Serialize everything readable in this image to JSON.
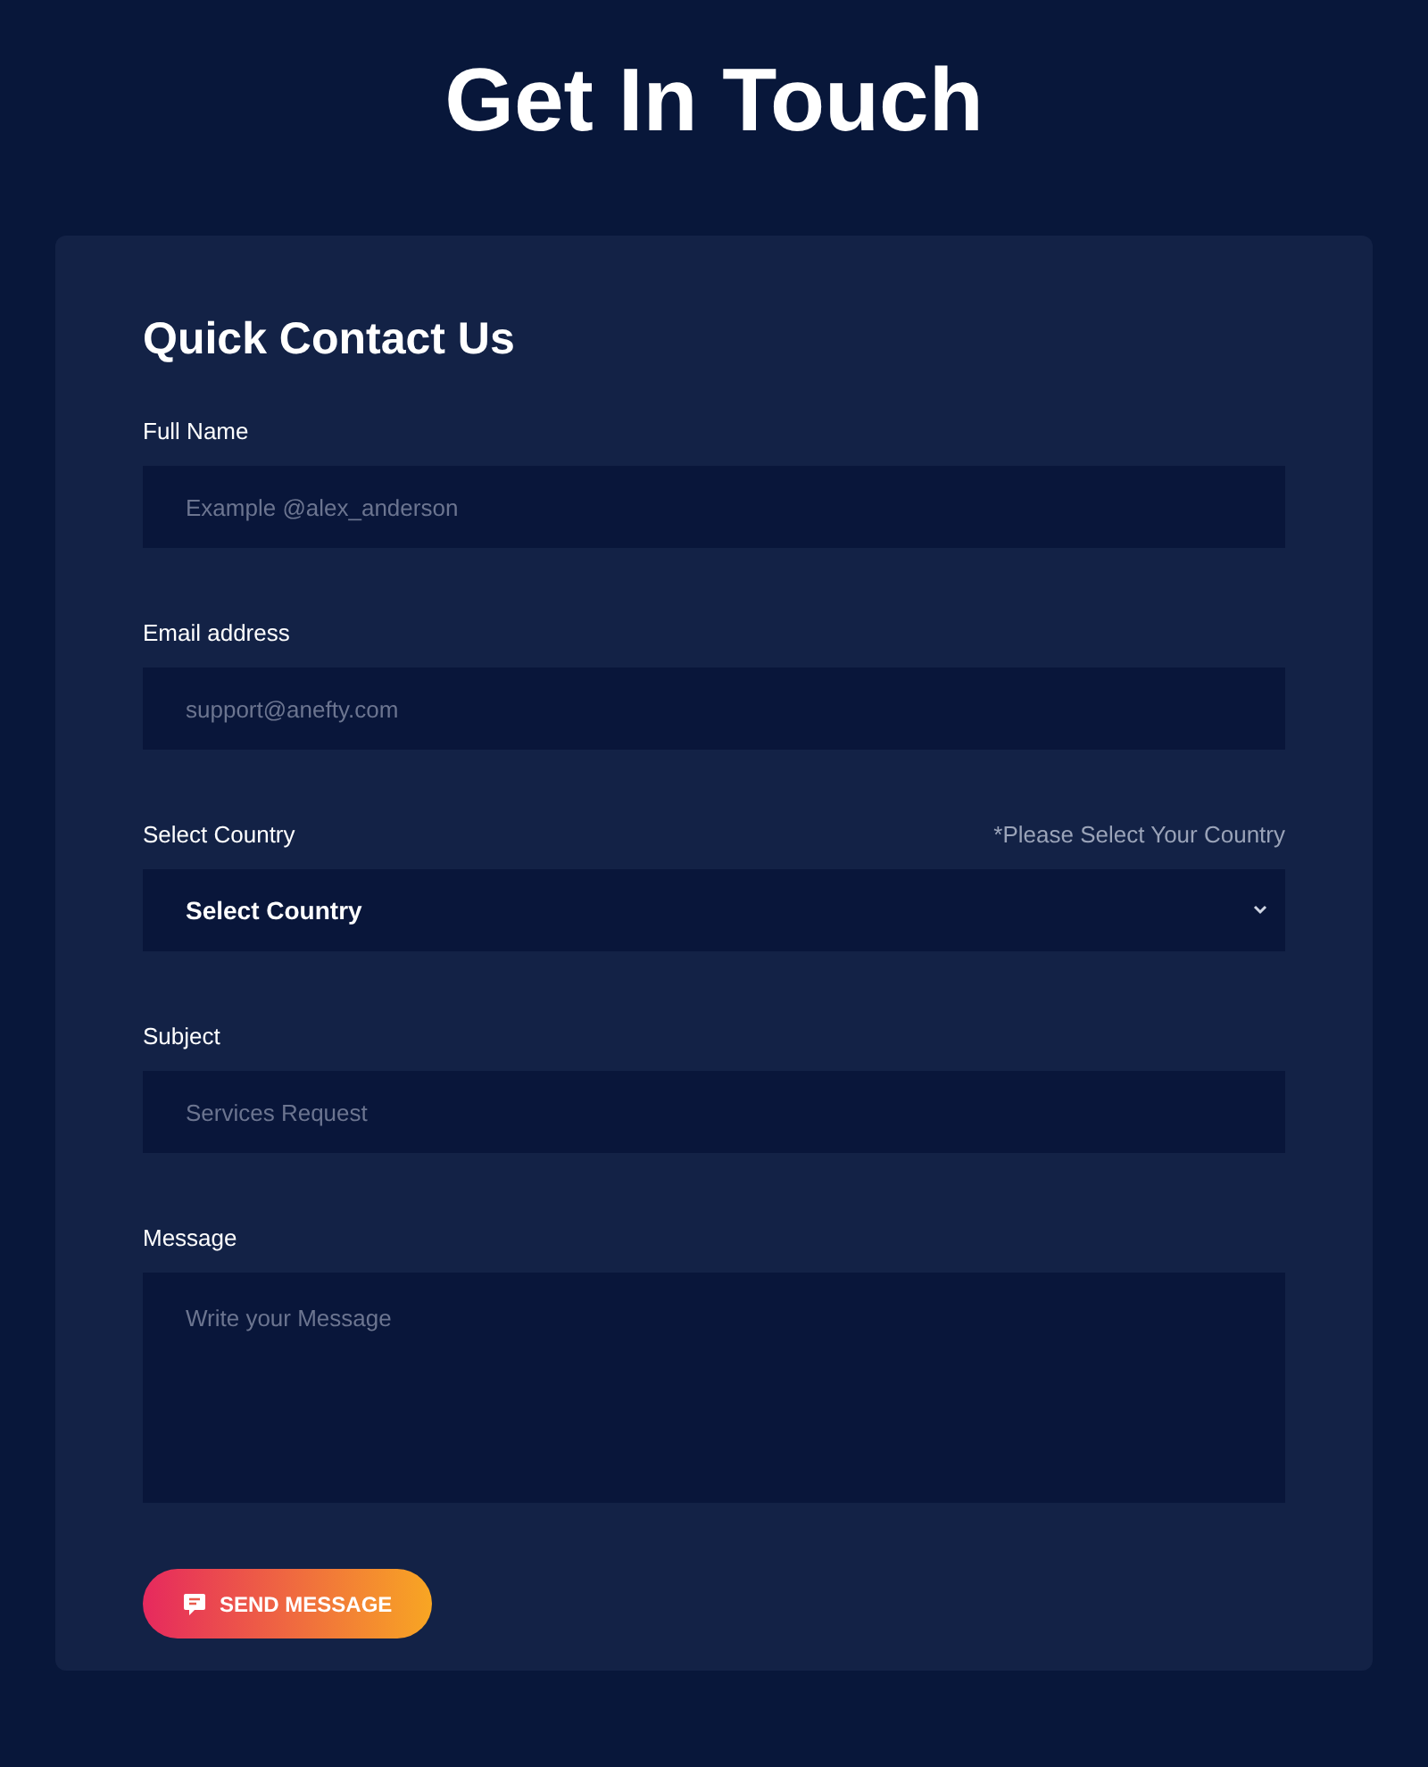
{
  "page_title": "Get In Touch",
  "form": {
    "title": "Quick Contact Us",
    "fields": [
      {
        "kind": "input",
        "label": "Full Name",
        "placeholder": "Example @alex_anderson"
      },
      {
        "kind": "input",
        "label": "Email address",
        "placeholder": "support@anefty.com"
      },
      {
        "kind": "select",
        "label": "Select Country",
        "hint": "*Please Select Your Country",
        "value": "Select Country"
      },
      {
        "kind": "input",
        "label": "Subject",
        "placeholder": "Services Request"
      },
      {
        "kind": "textarea",
        "label": "Message",
        "placeholder": "Write your Message"
      }
    ],
    "submit": "SEND MESSAGE"
  }
}
